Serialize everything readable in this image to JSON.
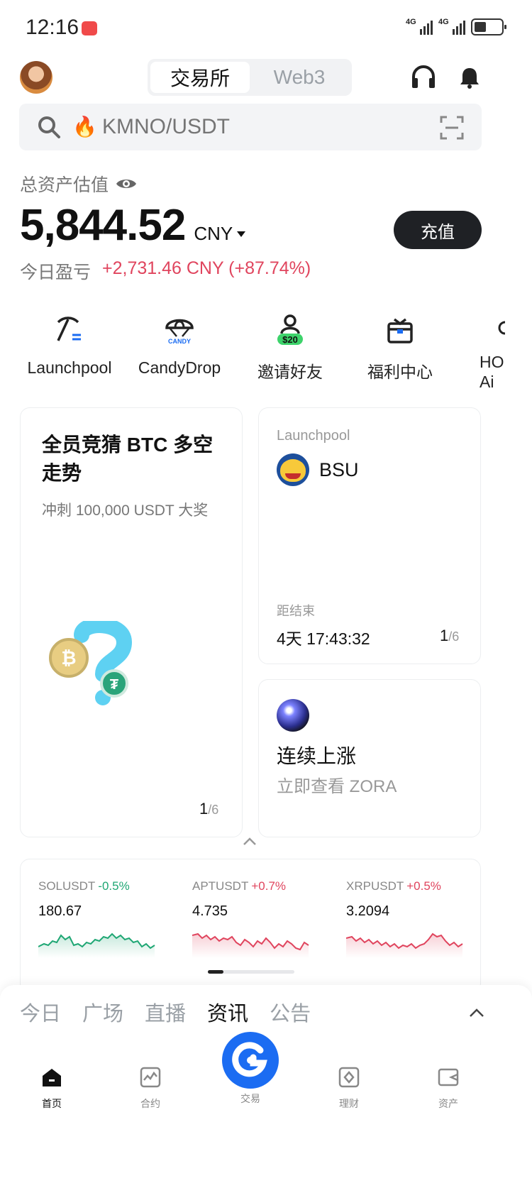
{
  "status_bar": {
    "time": "12:16",
    "network1": "4G",
    "network2": "4G"
  },
  "header": {
    "tabs": [
      {
        "label": "交易所",
        "active": true
      },
      {
        "label": "Web3",
        "active": false
      }
    ]
  },
  "search": {
    "placeholder": "KMNO/USDT"
  },
  "assets": {
    "label": "总资产估值",
    "amount": "5,844.52",
    "currency": "CNY",
    "deposit_label": "充值",
    "pnl_label": "今日盈亏",
    "pnl_value": "+2,731.46 CNY (+87.74%)"
  },
  "shortcuts": [
    {
      "label": "Launchpool",
      "icon": "pickaxe-icon"
    },
    {
      "label": "CandyDrop",
      "icon": "candy-parachute-icon"
    },
    {
      "label": "邀请好友",
      "icon": "invite-friend-icon",
      "badge": "$20"
    },
    {
      "label": "福利中心",
      "icon": "gift-icon"
    },
    {
      "label": "HO",
      "label2": "Ai",
      "icon": "partial-icon"
    }
  ],
  "cards": {
    "promo": {
      "title": "全员竞猜 BTC 多空走势",
      "subtitle": "冲刺 100,000 USDT 大奖",
      "page": "1",
      "total": "/6"
    },
    "launchpool": {
      "label": "Launchpool",
      "token": "BSU",
      "ends_label": "距结束",
      "countdown": "4天 17:43:32",
      "page": "1",
      "total": "/6"
    },
    "rising": {
      "title": "连续上涨",
      "subtitle": "立即查看 ZORA"
    }
  },
  "tickers": [
    {
      "symbol": "SOLUSDT",
      "change": "-0.5%",
      "price": "180.67",
      "color": "#1fa774"
    },
    {
      "symbol": "APTUSDT",
      "change": "+0.7%",
      "price": "4.735",
      "color": "#e0455e"
    },
    {
      "symbol": "XRPUSDT",
      "change": "+0.5%",
      "price": "3.2094",
      "color": "#e0455e"
    }
  ],
  "news_tabs": [
    {
      "label": "今日",
      "active": false
    },
    {
      "label": "广场",
      "active": false
    },
    {
      "label": "直播",
      "active": false
    },
    {
      "label": "资讯",
      "active": true
    },
    {
      "label": "公告",
      "active": false
    }
  ],
  "bottom_nav": {
    "home": "首页",
    "futures": "合约",
    "trade": "交易",
    "earn": "理财",
    "assets": "资产"
  },
  "colors": {
    "up": "#e0455e",
    "down": "#1fa774",
    "brand": "#1b6cf2"
  }
}
